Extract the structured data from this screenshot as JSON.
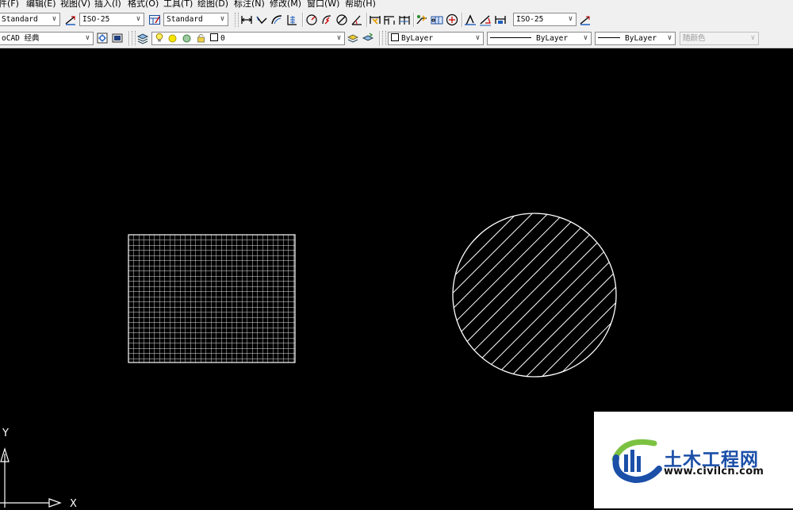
{
  "menubar": {
    "items": [
      "件(F)",
      "编辑(E)",
      "视图(V)",
      "插入(I)",
      "格式(O)",
      "工具(T)",
      "绘图(D)",
      "标注(N)",
      "修改(M)",
      "窗口(W)",
      "帮助(H)"
    ]
  },
  "toolbar1": {
    "text_style": "Standard",
    "dim_style": "ISO-25",
    "table_style": "Standard",
    "multileader_style": "ISO-25"
  },
  "toolbar2": {
    "workspace": "oCAD 经典",
    "layer": "0",
    "color": "ByLayer",
    "linetype": "ByLayer",
    "lineweight": "ByLayer",
    "plot_style": "随颜色"
  },
  "ucs": {
    "y_label": "Y",
    "x_label": "X"
  },
  "watermark": {
    "title": "土木工程网",
    "url": "www.civilcn.com"
  },
  "colors": {
    "canvas_background": "#000000",
    "entity": "#ffffff",
    "toolbar_background": "#f0f0f0",
    "logo_blue": "#1b4fa8",
    "logo_green": "#7cc242"
  },
  "icons": {
    "toolbar1": [
      "text-style-icon",
      "dim-style-icon",
      "table-style-icon",
      "linear-dim-icon",
      "aligned-dim-icon",
      "arc-length-icon",
      "ordinate-dim-icon",
      "radius-dim-icon",
      "jogged-dim-icon",
      "diameter-dim-icon",
      "angular-dim-icon",
      "quick-dim-icon",
      "baseline-dim-icon",
      "continue-dim-icon",
      "quick-leader-icon",
      "tolerance-icon",
      "center-mark-icon",
      "dim-edit-icon",
      "dim-text-edit-icon",
      "dim-update-icon",
      "multileader-style-icon"
    ],
    "toolbar2": [
      "workspace-settings-icon",
      "workspace-icon",
      "layer-properties-icon",
      "lightbulb-icon",
      "sun-icon",
      "freeze-icon",
      "lock-icon",
      "layer-color-icon",
      "make-current-icon",
      "layer-previous-icon"
    ]
  }
}
